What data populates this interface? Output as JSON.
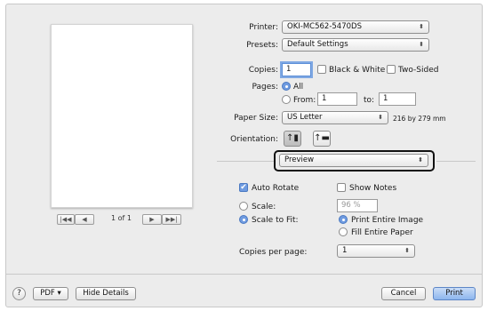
{
  "printer": {
    "label": "Printer:",
    "value": "OKI-MC562-5470DS"
  },
  "presets": {
    "label": "Presets:",
    "value": "Default Settings"
  },
  "copies": {
    "label": "Copies:",
    "value": "1",
    "bw_label": "Black & White",
    "twosided_label": "Two-Sided"
  },
  "pages": {
    "label": "Pages:",
    "all_label": "All",
    "from_label": "From:",
    "from_value": "1",
    "to_label": "to:",
    "to_value": "1"
  },
  "paper": {
    "label": "Paper Size:",
    "value": "US Letter",
    "dimensions": "216 by 279 mm"
  },
  "orientation": {
    "label": "Orientation:"
  },
  "section": {
    "value": "Preview"
  },
  "options": {
    "auto_rotate": "Auto Rotate",
    "show_notes": "Show Notes",
    "scale_label": "Scale:",
    "scale_value": "96 %",
    "scale_to_fit": "Scale to Fit:",
    "print_entire_image": "Print Entire Image",
    "fill_entire_paper": "Fill Entire Paper",
    "copies_per_page_label": "Copies per page:",
    "copies_per_page_value": "1"
  },
  "nav": {
    "first": "|◀◀",
    "prev": "◀",
    "page_count": "1 of 1",
    "next": "▶",
    "last": "▶▶|"
  },
  "footer": {
    "help": "?",
    "pdf": "PDF ▾",
    "hide_details": "Hide Details",
    "cancel": "Cancel",
    "print": "Print"
  },
  "icons": {
    "popup_arrows": "⬍",
    "checkmark": "✔",
    "portrait": "↑▮",
    "landscape": "↑▬"
  }
}
